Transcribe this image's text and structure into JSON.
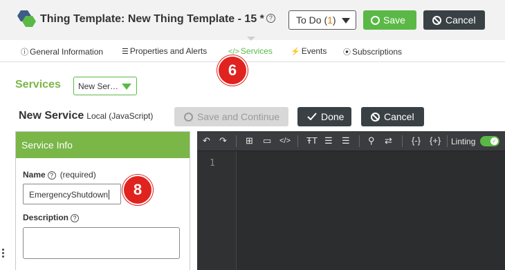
{
  "header": {
    "title": "Thing Template: New Thing Template - 15 *",
    "help_icon": "?",
    "state_label": "To Do (",
    "state_count": "1",
    "state_close": ")",
    "save_label": "Save",
    "cancel_label": "Cancel"
  },
  "tabs": [
    {
      "label": "General Information",
      "icon": "info-icon"
    },
    {
      "label": "Properties and Alerts",
      "icon": "list-icon"
    },
    {
      "label": "Services",
      "icon": "code-icon"
    },
    {
      "label": "Events",
      "icon": "bolt-icon"
    },
    {
      "label": "Subscriptions",
      "icon": "rss-icon"
    }
  ],
  "active_tab": "Services",
  "annotations": {
    "tab_badge": "6",
    "name_badge": "8"
  },
  "services_bar": {
    "label": "Services",
    "select_value": "New Ser…"
  },
  "new_service": {
    "title": "New Service",
    "subtitle": "Local (JavaScript)",
    "save_continue_label": "Save and Continue",
    "done_label": "Done",
    "cancel_label": "Cancel"
  },
  "service_info": {
    "heading": "Service Info",
    "name_label": "Name",
    "name_help": "?",
    "name_required": "(required)",
    "name_value": "EmergencyShutdown",
    "description_label": "Description",
    "description_help": "?",
    "description_value": ""
  },
  "editor": {
    "linting_label": "Linting",
    "linting_on": true,
    "line_numbers": [
      "1"
    ],
    "toolbar_icons": [
      "undo-icon",
      "redo-icon",
      "add-snippet-icon",
      "comment-icon",
      "code-tag-icon",
      "text-size-icon",
      "align-left-icon",
      "align-right-icon",
      "search-icon",
      "replace-icon",
      "fold-icon",
      "unfold-icon"
    ]
  },
  "colors": {
    "accent_green": "#5ab946",
    "panel_green": "#7ab648",
    "badge_red": "#e0231f",
    "dark_button": "#3a4145",
    "editor_bg": "#2b2d2f",
    "state_count": "#e07b00"
  }
}
